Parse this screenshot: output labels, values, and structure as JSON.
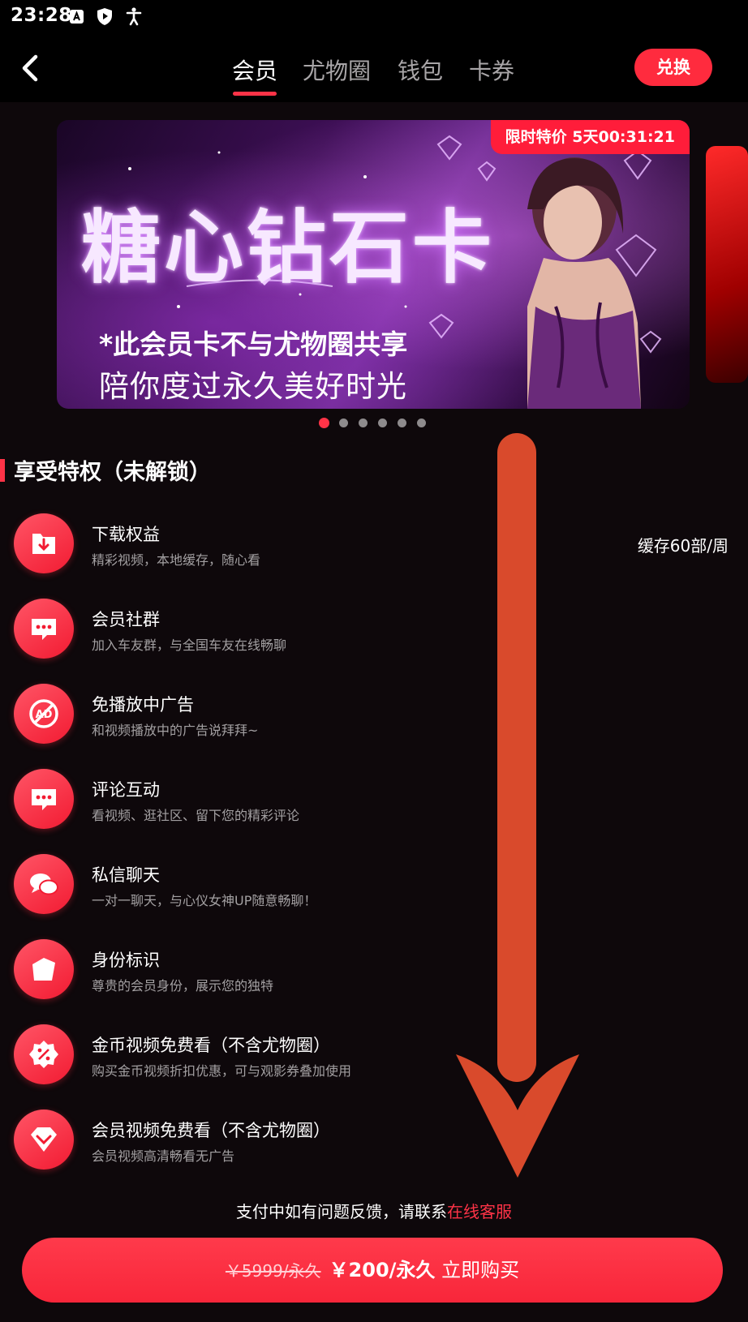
{
  "status_bar": {
    "time": "23:28",
    "icons": [
      "a-icon",
      "shield-icon",
      "accessibility-icon"
    ]
  },
  "nav": {
    "back_icon": "chevron-left-icon",
    "tabs": [
      {
        "label": "会员",
        "active": true
      },
      {
        "label": "尤物圈",
        "active": false
      },
      {
        "label": "钱包",
        "active": false
      },
      {
        "label": "卡券",
        "active": false
      }
    ],
    "exchange_label": "兑换"
  },
  "banner": {
    "badge": "限时特价 5天00:31:21",
    "title": "糖心钻石卡",
    "line1": "*此会员卡不与尤物圈共享",
    "line2": "陪你度过永久美好时光",
    "page_count": 6,
    "active_page": 1
  },
  "privileges": {
    "title": "享受特权（未解锁）",
    "items": [
      {
        "icon": "download-icon",
        "title": "下载权益",
        "desc": "精彩视频，本地缓存，随心看",
        "right": "缓存60部/周"
      },
      {
        "icon": "chat-bubble-icon",
        "title": "会员社群",
        "desc": "加入车友群，与全国车友在线畅聊"
      },
      {
        "icon": "no-ad-icon",
        "title": "免播放中广告",
        "desc": "和视频播放中的广告说拜拜~"
      },
      {
        "icon": "comment-icon",
        "title": "评论互动",
        "desc": "看视频、逛社区、留下您的精彩评论"
      },
      {
        "icon": "message-icon",
        "title": "私信聊天",
        "desc": "一对一聊天，与心仪女神UP随意畅聊！"
      },
      {
        "icon": "id-tag-icon",
        "title": "身份标识",
        "desc": "尊贵的会员身份，展示您的独特"
      },
      {
        "icon": "discount-badge-icon",
        "title": "金币视频免费看（不含尤物圈）",
        "desc": "购买金币视频折扣优惠，可与观影券叠加使用"
      },
      {
        "icon": "diamond-icon",
        "title": "会员视频免费看（不含尤物圈）",
        "desc": "会员视频高清畅看无广告"
      }
    ]
  },
  "help": {
    "text": "支付中如有问题反馈，请联系",
    "link": "在线客服"
  },
  "purchase": {
    "original_price": "￥5999/永久",
    "price": "￥200/永久",
    "action": "立即购买"
  },
  "colors": {
    "accent": "#ff3347",
    "background": "#0e080b",
    "annotation_arrow": "#d94a2c"
  }
}
